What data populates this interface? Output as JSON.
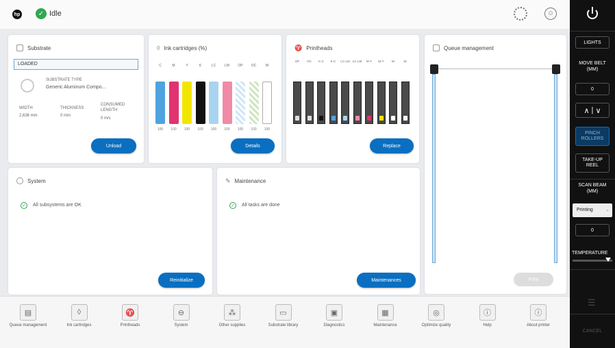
{
  "top": {
    "status": "Idle"
  },
  "substrate": {
    "title": "Substrate",
    "state": "LOADED",
    "type_label": "SUBSTRATE TYPE",
    "type_value": "Generic Aluminum Compo...",
    "width_label": "WIDTH",
    "width_value": "2,636 mm",
    "thickness_label": "THICKNESS",
    "thickness_value": "0 mm",
    "consumed_label": "CONSUMED LENGTH",
    "consumed_value": "0 m/s",
    "button": "Unload"
  },
  "ink": {
    "title": "Ink cartridges (%)",
    "labels": [
      "C",
      "M",
      "Y",
      "K",
      "LC",
      "LM",
      "OP",
      "OC",
      "W"
    ],
    "percents": [
      "100",
      "100",
      "100",
      "100",
      "100",
      "100",
      "100",
      "100",
      "100"
    ],
    "button": "Details"
  },
  "printheads": {
    "title": "Printheads",
    "labels": [
      "OP",
      "OC",
      "K-C",
      "K-C",
      "LC-LM",
      "LC-LM",
      "M-Y",
      "M-Y",
      "W",
      "W"
    ],
    "button": "Replace"
  },
  "queue": {
    "title": "Queue management",
    "button": "Print"
  },
  "system": {
    "title": "System",
    "status": "All subsystems are OK",
    "button": "Reinitialize"
  },
  "maintenance": {
    "title": "Maintenance",
    "status": "All tasks are done",
    "button": "Maintenances"
  },
  "nav": [
    {
      "label": "Queue management",
      "icon": "queue-icon"
    },
    {
      "label": "Ink cartridges",
      "icon": "ink-drop-icon"
    },
    {
      "label": "Printheads",
      "icon": "printhead-icon"
    },
    {
      "label": "System",
      "icon": "system-icon"
    },
    {
      "label": "Other supplies",
      "icon": "supplies-icon"
    },
    {
      "label": "Substrate library",
      "icon": "substrate-library-icon"
    },
    {
      "label": "Diagnostics",
      "icon": "diagnostics-icon"
    },
    {
      "label": "Maintenance",
      "icon": "maintenance-icon"
    },
    {
      "label": "Optimize quality",
      "icon": "optimize-icon"
    },
    {
      "label": "Help",
      "icon": "help-icon"
    },
    {
      "label": "About printer",
      "icon": "about-icon"
    }
  ],
  "side": {
    "lights": "LIGHTS",
    "move_belt": "MOVE BELT (MM)",
    "move_value": "0",
    "pinch": "PINCH ROLLERS",
    "takeup": "TAKE-UP REEL",
    "scan_beam": "SCAN BEAM (MM)",
    "printing": "Printing",
    "scan_value": "0",
    "temperature": "TEMPERATURE",
    "cancel": "CANCEL"
  },
  "colors": {
    "accent": "#0a6fc1",
    "ok": "#2fa84f",
    "cyan": "#4fa3df",
    "magenta": "#e0336f",
    "yellow": "#f2e600",
    "black": "#111111",
    "light_cyan": "#a9d4ef",
    "light_magenta": "#f08aa6"
  }
}
